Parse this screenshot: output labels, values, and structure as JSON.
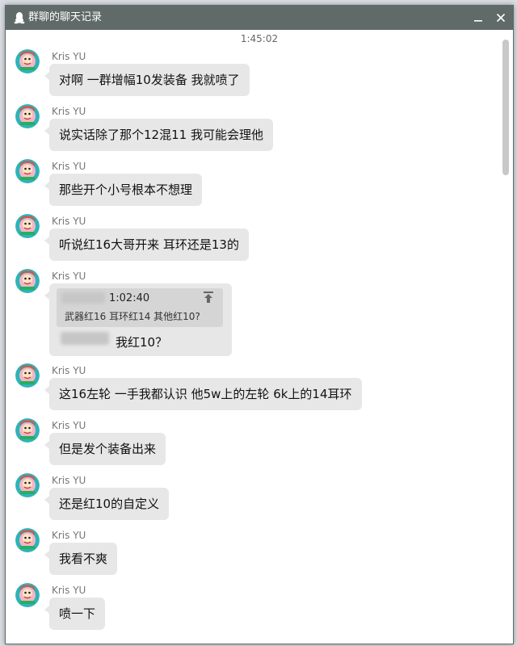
{
  "window": {
    "title": "群聊的聊天记录",
    "minimize_icon": "minimize-icon",
    "close_icon": "close-icon",
    "app_icon": "qq-penguin-icon",
    "colors": {
      "titlebar": "#5f6a69",
      "bubble": "#e7e7e7",
      "quote": "#d5d5d5"
    }
  },
  "top_timestamp": "1:45:02",
  "messages": [
    {
      "sender": "Kris YU",
      "text": "对啊 一群增幅10发装备 我就喷了"
    },
    {
      "sender": "Kris YU",
      "text": "说实话除了那个12混11 我可能会理他"
    },
    {
      "sender": "Kris YU",
      "text": "那些开个小号根本不想理"
    },
    {
      "sender": "Kris YU",
      "text": "听说红16大哥开来 耳环还是13的"
    },
    {
      "sender": "Kris YU",
      "quote": {
        "time": "1:02:40",
        "text": "武器红16 耳环红14 其他红10?"
      },
      "text": "我红10？"
    },
    {
      "sender": "Kris YU",
      "text": "这16左轮 一手我都认识 他5w上的左轮 6k上的14耳环"
    },
    {
      "sender": "Kris YU",
      "text": "但是发个装备出来"
    },
    {
      "sender": "Kris YU",
      "text": "还是红10的自定义"
    },
    {
      "sender": "Kris YU",
      "text": "我看不爽"
    },
    {
      "sender": "Kris YU",
      "text": "喷一下"
    }
  ]
}
